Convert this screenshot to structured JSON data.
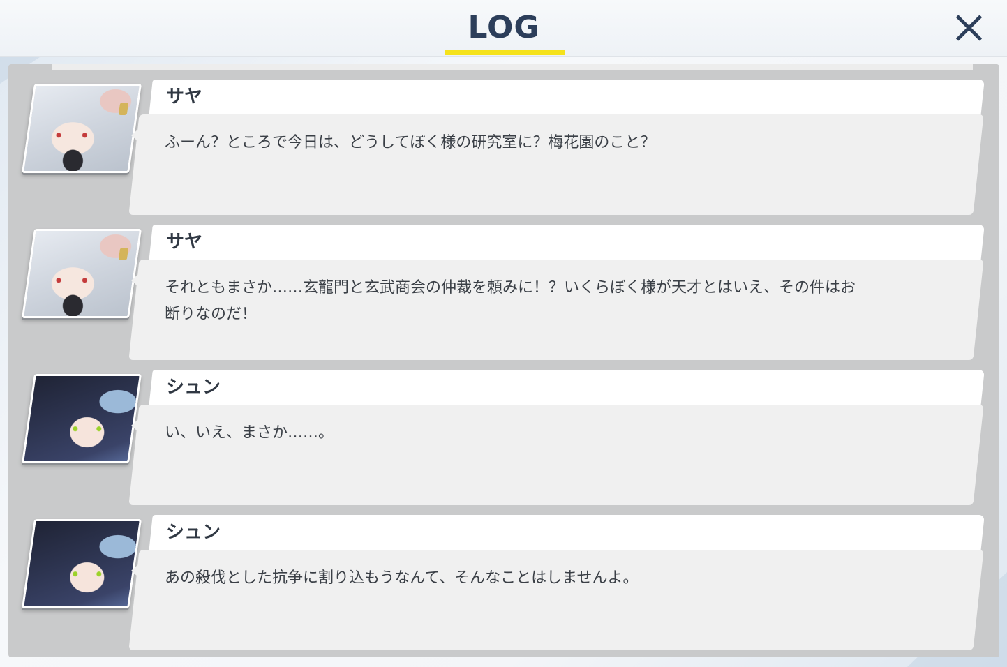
{
  "header": {
    "title": "LOG",
    "close_icon": "close-icon"
  },
  "colors": {
    "title": "#2c3e5a",
    "accent_underline": "#f5e21c",
    "panel_bg": "#c9cacb",
    "bubble_bg": "#f0f0f0",
    "name_bg": "#ffffff"
  },
  "entries": [
    {
      "speaker": "サヤ",
      "portrait": "saya-portrait",
      "message": "ふーん？ところで今日は、どうしてぼく様の研究室に？梅花園のこと？"
    },
    {
      "speaker": "サヤ",
      "portrait": "saya-portrait",
      "message": "それともまさか……玄龍門と玄武商会の仲裁を頼みに！？いくらぼく様が天才とはいえ、その件はお断りなのだ！"
    },
    {
      "speaker": "シュン",
      "portrait": "shun-portrait",
      "message": "い、いえ、まさか……。"
    },
    {
      "speaker": "シュン",
      "portrait": "shun-portrait",
      "message": "あの殺伐とした抗争に割り込もうなんて、そんなことはしませんよ。"
    }
  ]
}
